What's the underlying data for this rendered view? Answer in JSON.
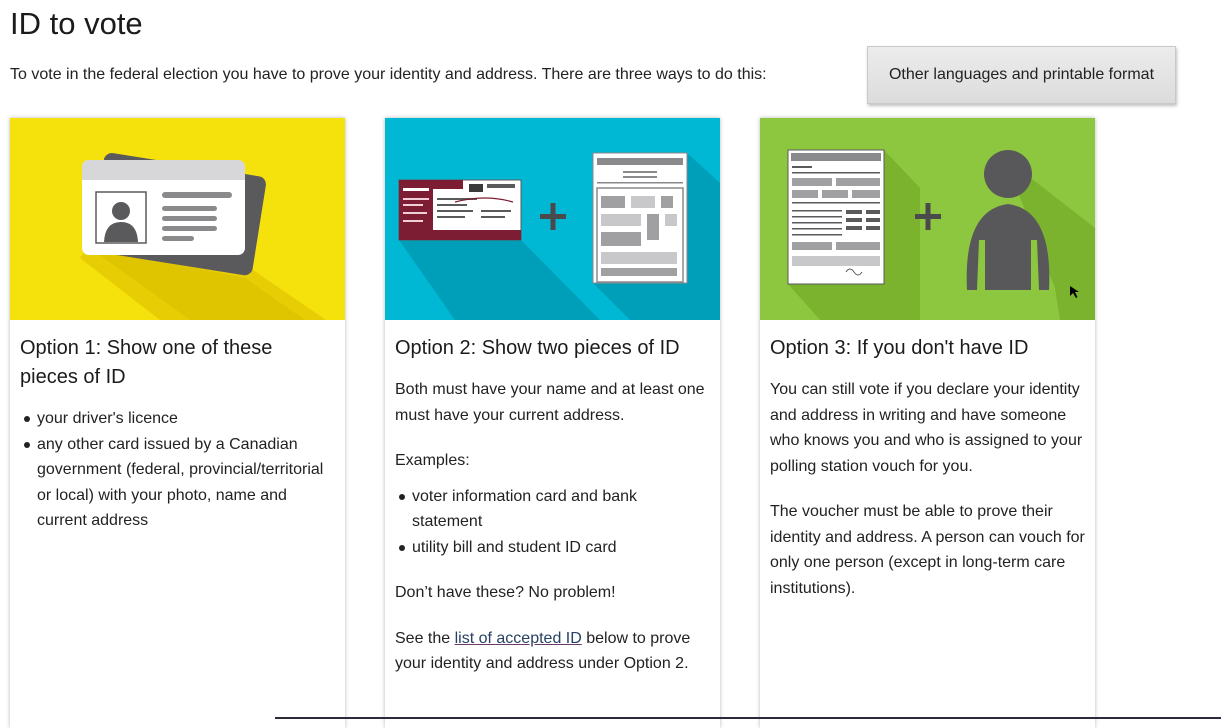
{
  "page": {
    "title": "ID to vote",
    "intro": "To vote in the federal election you have to prove your identity and address. There are three ways to do this:",
    "lang_button": "Other languages and printable format"
  },
  "colors": {
    "option1_bg": "#f5e10c",
    "option2_bg": "#00b7d4",
    "option3_bg": "#8dc63f",
    "shape_dark": "#5a5a5d"
  },
  "icons": {
    "option1": "id-cards-icon",
    "option2": "document-plus-document-icon",
    "option3": "form-plus-person-icon"
  },
  "option1": {
    "heading": "Option 1: Show one of these pieces of ID",
    "items": [
      "your driver's licence",
      "any other card issued by a Canadian government (federal, provincial/territorial or local) with your photo, name and current address"
    ]
  },
  "option2": {
    "heading": "Option 2: Show two pieces of ID",
    "text1": "Both must have your name and at least one must have your current address.",
    "examples_label": "Examples:",
    "items": [
      "voter information card and bank statement",
      "utility bill and student ID card"
    ],
    "no_problem": "Don’t have these? No problem!",
    "see_prefix": "See the ",
    "link_text": "list of accepted ID",
    "see_suffix": " below to prove your identity and address under Option 2."
  },
  "option3": {
    "heading": "Option 3: If you don't have ID",
    "text1": "You can still vote if you declare your identity and address in writing and have someone who knows you and who is assigned to your polling station vouch for you.",
    "text2": "The voucher must be able to prove their identity and address. A person can vouch for only one person (except in long-term care institutions)."
  }
}
